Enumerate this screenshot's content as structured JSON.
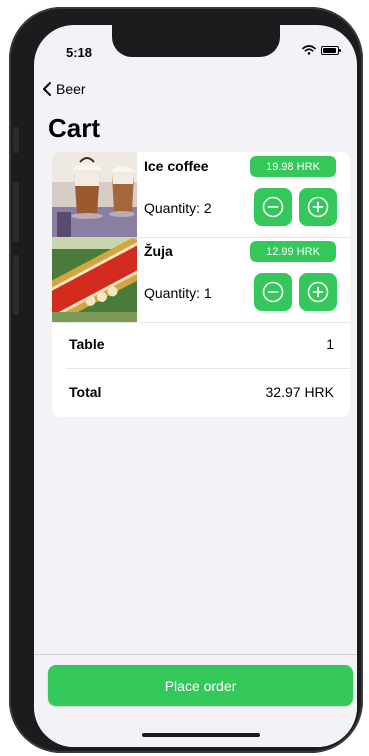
{
  "status": {
    "time": "5:18"
  },
  "nav": {
    "back_label": "Beer"
  },
  "page": {
    "title": "Cart"
  },
  "cart": {
    "items": [
      {
        "name": "Ice coffee",
        "price": "19.98 HRK",
        "quantity_text": "Quantity: 2"
      },
      {
        "name": "Žuja",
        "price": "12.99 HRK",
        "quantity_text": "Quantity: 1"
      }
    ],
    "table_label": "Table",
    "table_value": "1",
    "total_label": "Total",
    "total_value": "32.97 HRK"
  },
  "actions": {
    "place_order_label": "Place order"
  },
  "colors": {
    "accent": "#34c759",
    "background": "#f2f2f7"
  },
  "icons": [
    "chevron-left-icon",
    "wifi-icon",
    "battery-icon",
    "minus-circle-icon",
    "plus-circle-icon"
  ]
}
